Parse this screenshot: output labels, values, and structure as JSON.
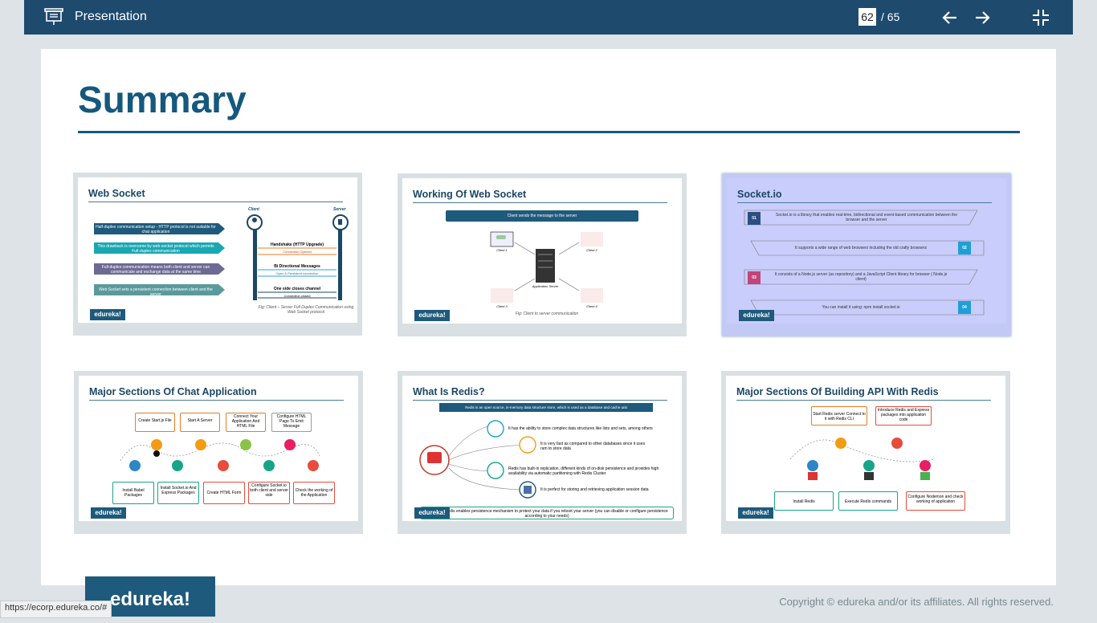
{
  "topbar": {
    "title": "Presentation",
    "page_current": "62",
    "page_total": "/ 65"
  },
  "slide": {
    "title": "Summary",
    "footer_brand": "edureka!",
    "footer_copyright": "Copyright © edureka and/or its affiliates. All rights reserved.",
    "colors": {
      "accent": "#15587d",
      "bar": "#1e4a6e",
      "active_thumb": "#c9cdfb"
    }
  },
  "thumbnails": [
    {
      "title": "Web Socket",
      "brand": "edureka!",
      "client_label": "Client",
      "server_label": "Server",
      "points": [
        "Half-duplex communication setup - HTTP protocol is not suitable for chat application",
        "This drawback is overcome by web-socket protocol which permits Full-duplex communication",
        "Full-duplex communication means both client and server can communicate and exchange data at the same time",
        "Web Socket sets a persistent connection between client and the server"
      ],
      "messages": [
        "Handshake (HTTP Upgrade)",
        "Connection Opened",
        "Bi Directional Messages",
        "Open & Persistent connection",
        "One side closes channel",
        "Connection closed"
      ],
      "caption": "Fig: Client – Server Full Duplex Communication using Web Socket protocol"
    },
    {
      "title": "Working Of Web Socket",
      "brand": "edureka!",
      "banner": "Client sends the message to the server",
      "nodes": [
        "Client 1",
        "Client 2",
        "Application Server",
        "Client 3",
        "Client 4"
      ],
      "caption": "Fig: Client to server communication"
    },
    {
      "title": "Socket.io",
      "brand": "edureka!",
      "items": [
        {
          "num": "01",
          "text": "Socket.io is a library that enables real-time, bidirectional and event-based communication between the browser and the server"
        },
        {
          "num": "02",
          "text": "It supports a wide range of web browsers including the old crafty browsers"
        },
        {
          "num": "03",
          "text": "It consists of a Node.js server (as repository) and a JavaScript Client library for browser ( Node.js client)"
        },
        {
          "num": "04",
          "text": "You can install it using: npm install socket.io"
        }
      ]
    },
    {
      "title": "Major Sections Of Chat Application",
      "brand": "edureka!",
      "top_steps": [
        "Create Start.js File",
        "Start A Server",
        "Connect Your Application And HTML File",
        "Configure HTML Page To Emit Message"
      ],
      "bottom_steps": [
        "Install Babel Packages",
        "Install Socket.io And Express Packages",
        "Create HTML Form",
        "Configure Socket.io both client and server side",
        "Check the working of the Application"
      ]
    },
    {
      "title": "What Is Redis?",
      "brand": "edureka!",
      "banner": "Redis is an open source, in-memory data structure store, which is used as a database and cache unit",
      "logo_label": "Redis",
      "points": [
        "It has the ability to store complex data structures like lists and sets, among others",
        "It is very fast as compared to other databases since it uses ram to store data",
        "Redis has built-in replication, different kinds of on-disk persistence and provides high availability via automatic partitioning with Redis Cluster",
        "It is perfect for storing and retrieving application session data"
      ],
      "note": "By default Redis enables persistence mechanism to protect your data if you reboot your server (you can disable or configure persistence according to your needs)"
    },
    {
      "title": "Major Sections Of Building API With Redis",
      "brand": "edureka!",
      "top_steps": [
        "Start Redis server Connect to it with Redis CLI",
        "Introduce Redis and Express packages into application code"
      ],
      "bottom_steps": [
        "Install Redis",
        "Execute Redis commands",
        "Configure Nodemon and check working of application"
      ]
    }
  ],
  "status_bar": {
    "url": "https://ecorp.edureka.co/#"
  }
}
